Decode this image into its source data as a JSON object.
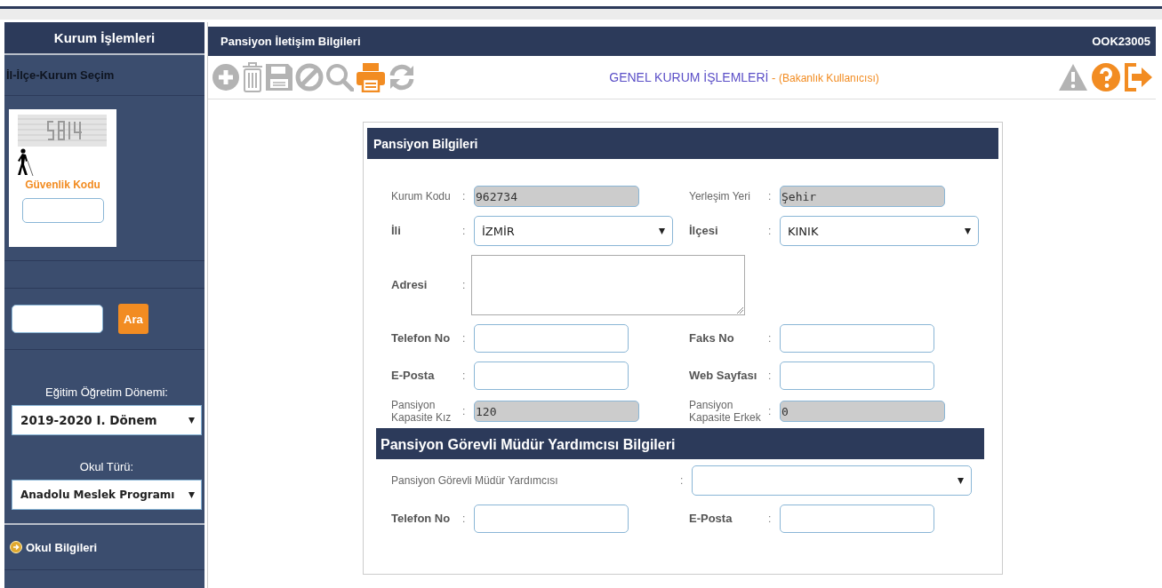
{
  "sidebar": {
    "title": "Kurum İşlemleri",
    "section_label": "İl-İlçe-Kurum Seçim",
    "captcha_label": "Güvenlik Kodu",
    "search_button": "Ara",
    "period_label": "Eğitim Öğretim Dönemi:",
    "period_value": "2019-2020 I. Dönem",
    "school_type_label": "Okul Türü:",
    "school_type_value": "Anadolu Meslek Programı",
    "menu_items": [
      {
        "label": "Okul Bilgileri"
      }
    ]
  },
  "main": {
    "title": "Pansiyon İletişim Bilgileri",
    "code": "OOK23005",
    "toolbar": [
      {
        "kind": "add",
        "disabled": true
      },
      {
        "kind": "delete",
        "disabled": true
      },
      {
        "kind": "save",
        "disabled": true
      },
      {
        "kind": "cancel",
        "disabled": true
      },
      {
        "kind": "search",
        "disabled": true
      },
      {
        "kind": "print",
        "disabled": false
      },
      {
        "kind": "refresh",
        "disabled": true
      }
    ],
    "heading": "GENEL KURUM İŞLEMLERİ",
    "heading_separator": " - ",
    "heading_role": "(Bakanlık Kullanıcısı)",
    "right_tools": [
      {
        "kind": "warning",
        "disabled": true
      },
      {
        "kind": "help",
        "disabled": false
      },
      {
        "kind": "exit",
        "disabled": false
      }
    ]
  },
  "form": {
    "sections": [
      {
        "title": "Pansiyon Bilgileri",
        "rows": [
          [
            {
              "label": "Kurum Kodu",
              "separator": ":",
              "label_bold": false,
              "kind": "readonly",
              "value": "962734"
            },
            {
              "label": "Yerleşim Yeri",
              "separator": ":",
              "label_bold": false,
              "kind": "readonly",
              "value": "Şehir"
            }
          ],
          [
            {
              "label": "İli",
              "separator": ":",
              "label_bold": true,
              "kind": "select",
              "value": "İZMİR"
            },
            {
              "label": "İlçesi",
              "separator": ":",
              "label_bold": true,
              "kind": "select",
              "value": "KINIK"
            }
          ],
          [
            {
              "label": "Adresi",
              "separator": ":",
              "label_bold": true,
              "kind": "textarea"
            }
          ],
          [
            {
              "label": "Telefon No",
              "separator": ":",
              "label_bold": true,
              "kind": "text"
            },
            {
              "label": "Faks No",
              "separator": ":",
              "label_bold": true,
              "kind": "text"
            }
          ],
          [
            {
              "label": "E-Posta",
              "separator": ":",
              "label_bold": true,
              "kind": "text"
            },
            {
              "label": "Web Sayfası",
              "separator": ":",
              "label_bold": true,
              "kind": "text"
            }
          ],
          [
            {
              "label": "Pansiyon Kapasite Kız",
              "separator": ":",
              "label_bold": false,
              "kind": "readonly",
              "value": "120"
            },
            {
              "label": "Pansiyon Kapasite Erkek",
              "separator": ":",
              "label_bold": false,
              "kind": "readonly",
              "value": "0"
            }
          ]
        ]
      },
      {
        "title": "Pansiyon Görevli Müdür Yardımcısı Bilgileri",
        "rows": [
          [
            {
              "label": "Pansiyon Görevli Müdür Yardımcısı",
              "separator": ":",
              "label_bold": false,
              "kind": "wideselect"
            }
          ],
          [
            {
              "label": "Telefon No",
              "separator": ":",
              "label_bold": true,
              "kind": "text"
            },
            {
              "label": "E-Posta",
              "separator": ":",
              "label_bold": true,
              "kind": "text"
            }
          ]
        ]
      }
    ]
  }
}
